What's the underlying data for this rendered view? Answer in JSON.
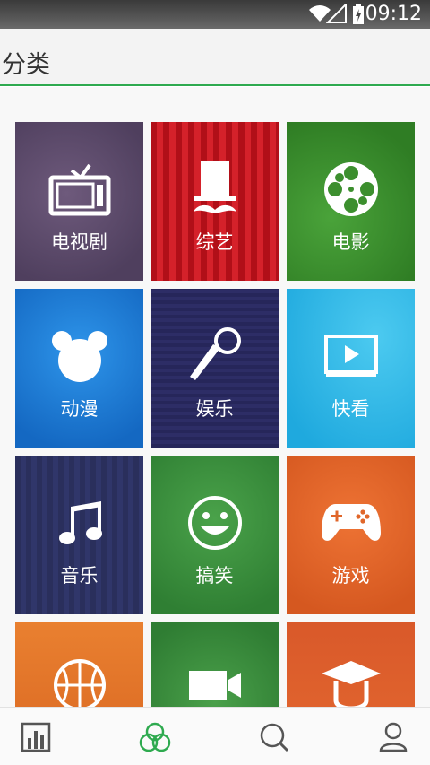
{
  "status": {
    "time": "09:12"
  },
  "header": {
    "title": "分类"
  },
  "categories": [
    {
      "label": "电视剧",
      "icon": "tv-icon",
      "color": "#5d4a6a"
    },
    {
      "label": "综艺",
      "icon": "top-hat-mustache-icon",
      "color": "#c4141c"
    },
    {
      "label": "电影",
      "icon": "film-reel-icon",
      "color": "#3c8f2e"
    },
    {
      "label": "动漫",
      "icon": "mickey-icon",
      "color": "#1a7fd6"
    },
    {
      "label": "娱乐",
      "icon": "microphone-icon",
      "color": "#28285a"
    },
    {
      "label": "快看",
      "icon": "play-screen-icon",
      "color": "#2db8e6"
    },
    {
      "label": "音乐",
      "icon": "music-note-icon",
      "color": "#2a2f5c"
    },
    {
      "label": "搞笑",
      "icon": "smiley-icon",
      "color": "#3c9140"
    },
    {
      "label": "游戏",
      "icon": "gamepad-icon",
      "color": "#e0662a"
    },
    {
      "label": "",
      "icon": "basketball-icon",
      "color": "#e07426"
    },
    {
      "label": "",
      "icon": "video-camera-icon",
      "color": "#3a8a3a"
    },
    {
      "label": "",
      "icon": "graduation-cap-icon",
      "color": "#e0622c"
    }
  ],
  "nav": [
    {
      "name": "chart-icon",
      "active": false
    },
    {
      "name": "category-icon",
      "active": true
    },
    {
      "name": "search-icon",
      "active": false
    },
    {
      "name": "profile-icon",
      "active": false
    }
  ],
  "colors": {
    "accent": "#2eaa4f"
  }
}
